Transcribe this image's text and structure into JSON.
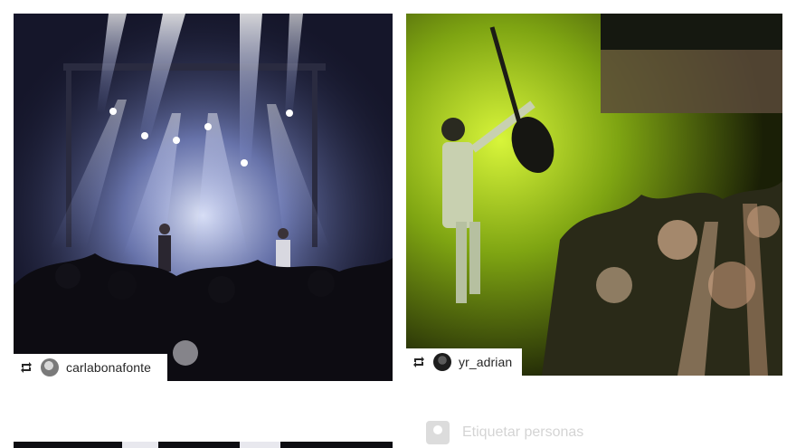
{
  "posts": [
    {
      "username": "carlabonafonte",
      "regram_icon": "regram-icon",
      "avatar": "avatar"
    },
    {
      "username": "yr_adrian",
      "regram_icon": "regram-icon",
      "avatar": "avatar"
    }
  ],
  "tag_people": {
    "label": "Etiquetar personas",
    "icon": "tag-person-icon"
  },
  "colors": {
    "stage_light": "#c9d4ff",
    "green_light": "#c6f01a"
  }
}
